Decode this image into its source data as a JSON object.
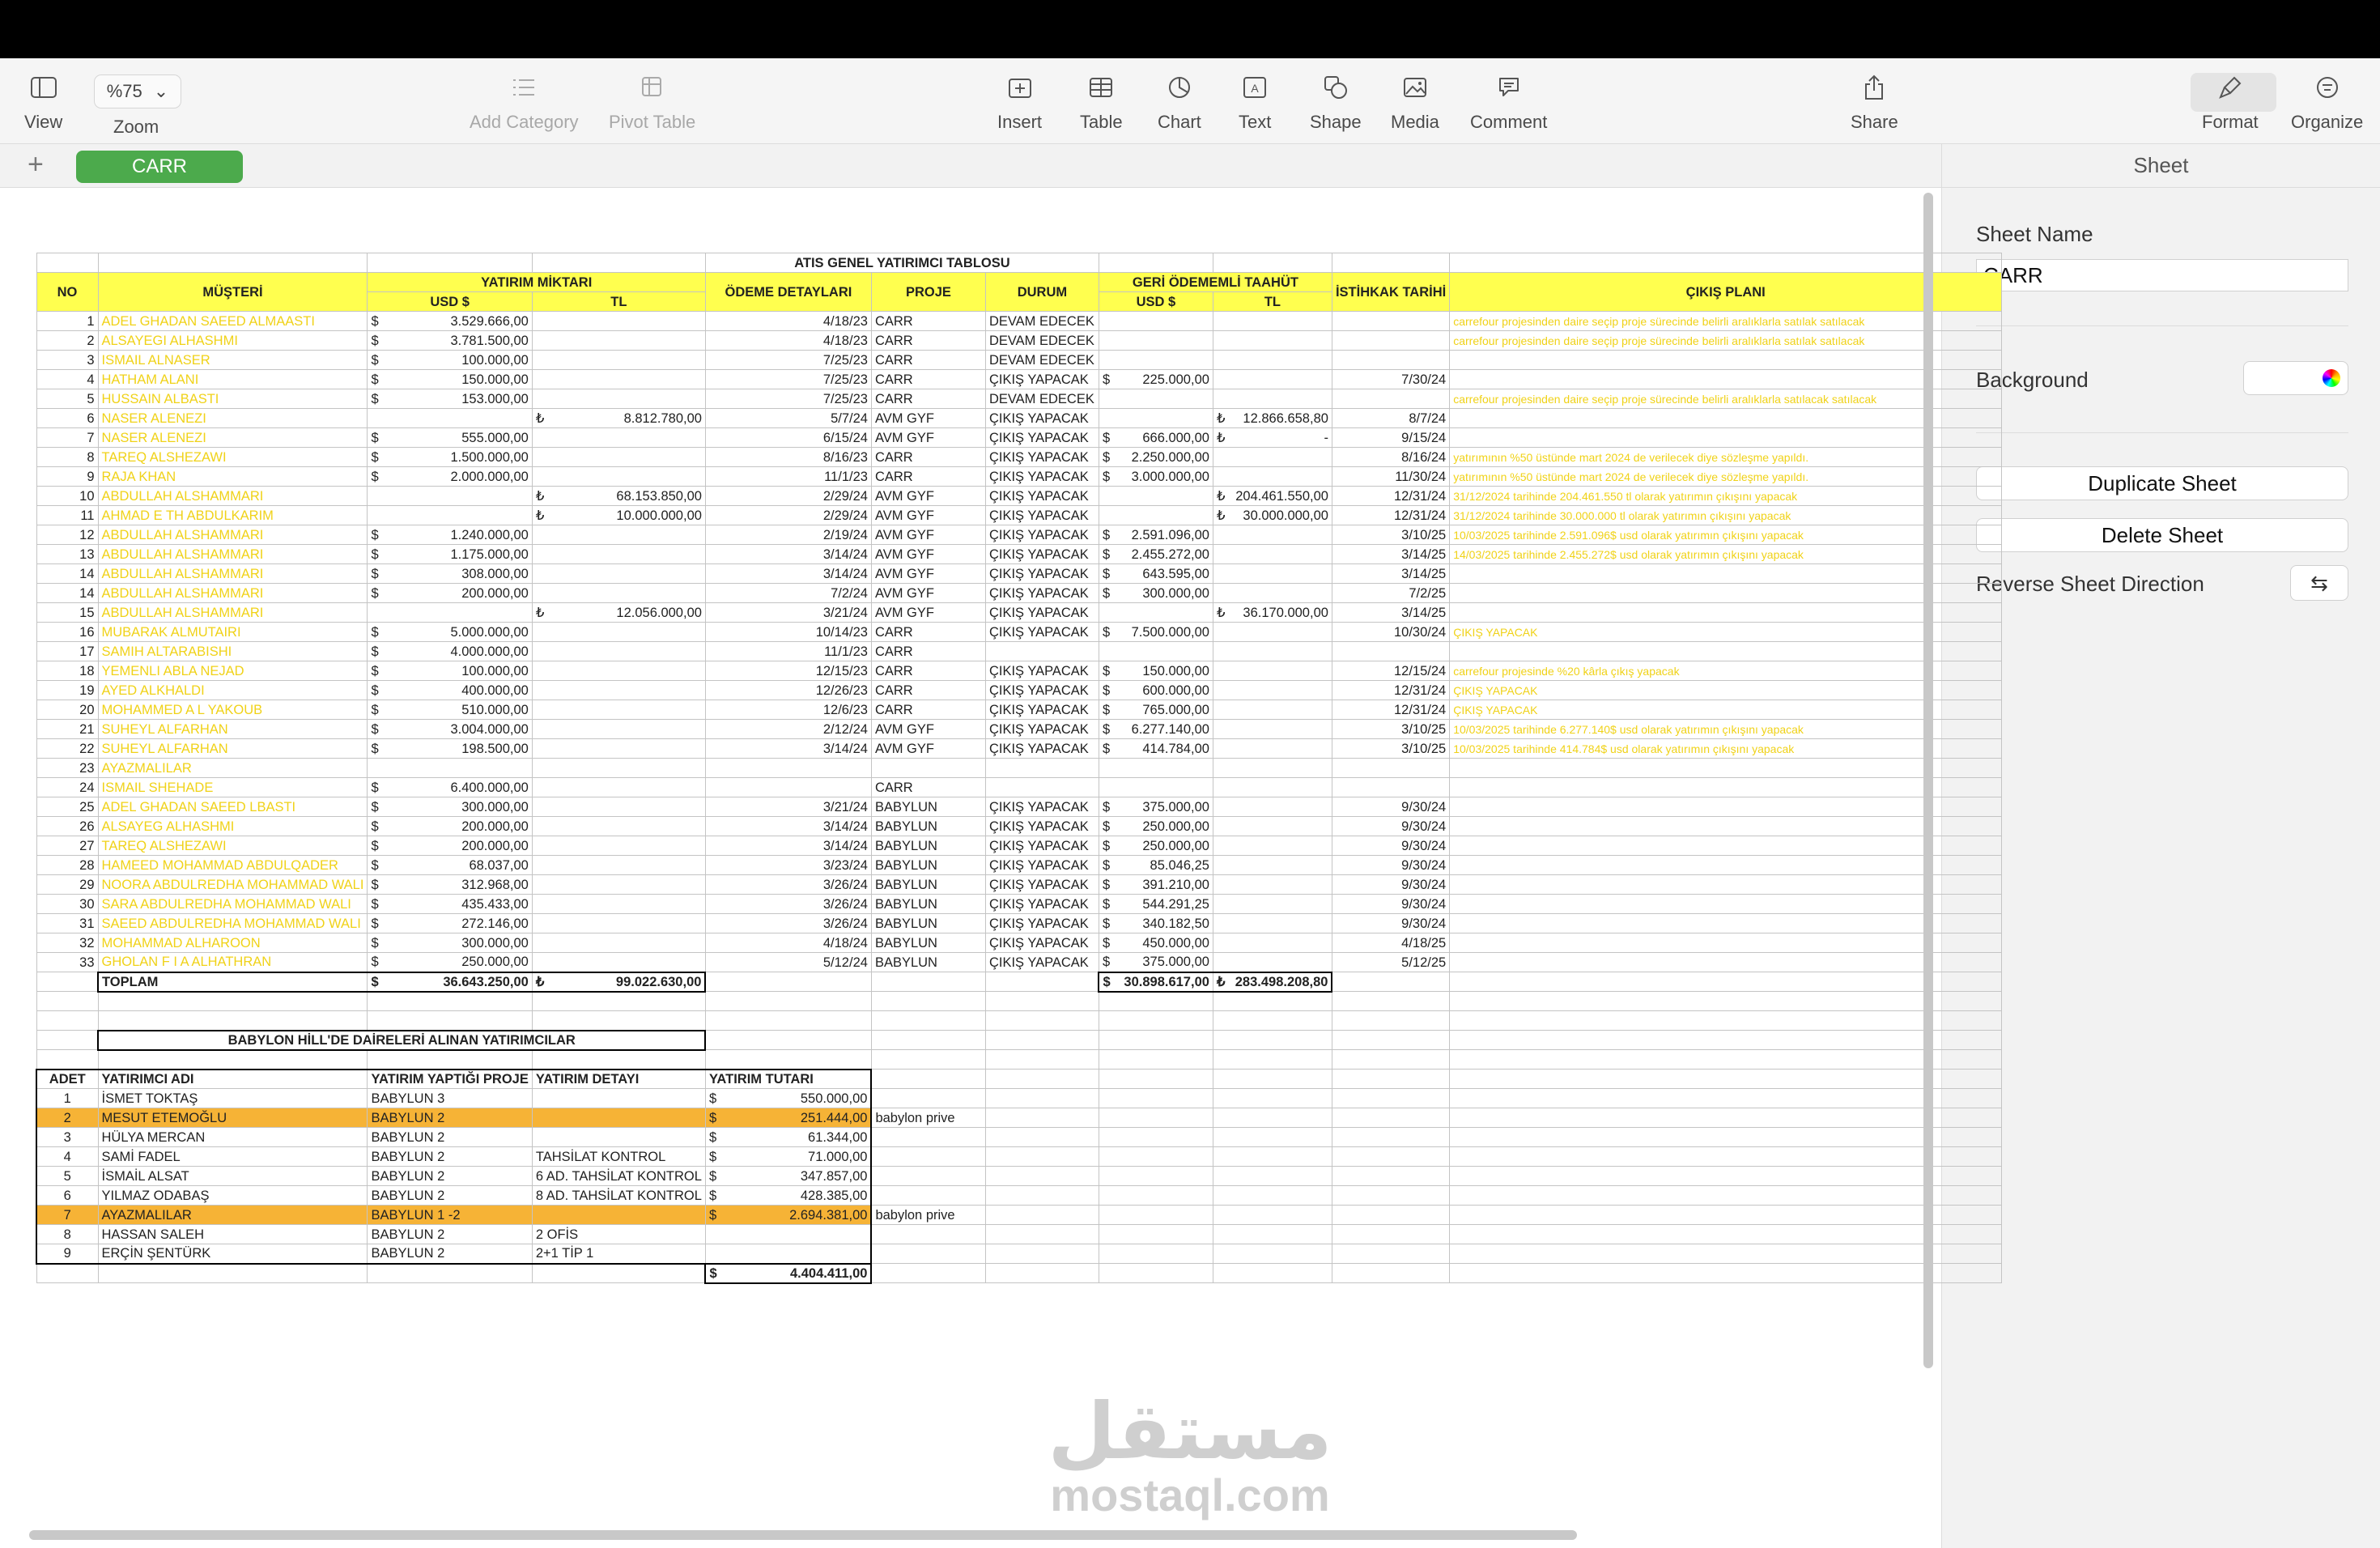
{
  "toolbar": {
    "view": "View",
    "zoom_value": "%75",
    "zoom": "Zoom",
    "add_category": "Add Category",
    "pivot_table": "Pivot Table",
    "insert": "Insert",
    "table": "Table",
    "chart": "Chart",
    "text": "Text",
    "shape": "Shape",
    "media": "Media",
    "comment": "Comment",
    "share": "Share",
    "format": "Format",
    "organize": "Organize"
  },
  "tabs": {
    "add": "+",
    "sheet": "CARR"
  },
  "sidebar": {
    "header": "Sheet",
    "sheet_name_label": "Sheet Name",
    "sheet_name_value": "CARR",
    "background_label": "Background",
    "duplicate": "Duplicate Sheet",
    "delete": "Delete Sheet",
    "reverse": "Reverse Sheet Direction"
  },
  "main": {
    "title": "ATIS GENEL YATIRIMCI TABLOSU",
    "headers": {
      "no": "NO",
      "musteri": "MÜŞTERİ",
      "yatirim": "YATIRIM MİKTARI",
      "usd": "USD $",
      "tl": "TL",
      "odeme": "ÖDEME DETAYLARI",
      "proje": "PROJE",
      "durum": "DURUM",
      "geri": "GERİ ÖDEMEMLİ TAAHÜT",
      "istihkak": "İSTİHKAK TARİHİ",
      "cikis": "ÇIKIŞ PLANI"
    },
    "rows": [
      [
        "1",
        "ADEL GHADAN SAEED ALMAASTI",
        "3.529.666,00",
        "",
        "4/18/23",
        "CARR",
        "DEVAM EDECEK",
        "",
        "",
        "",
        "carrefour projesinden daire seçip proje sürecinde belirli aralıklarla satılak satılacak"
      ],
      [
        "2",
        "ALSAYEGI ALHASHMI",
        "3.781.500,00",
        "",
        "4/18/23",
        "CARR",
        "DEVAM EDECEK",
        "",
        "",
        "",
        "carrefour projesinden daire seçip proje sürecinde belirli aralıklarla satılak satılacak"
      ],
      [
        "3",
        "ISMAIL ALNASER",
        "100.000,00",
        "",
        "7/25/23",
        "CARR",
        "DEVAM EDECEK",
        "",
        "",
        "",
        ""
      ],
      [
        "4",
        "HATHAM ALANI",
        "150.000,00",
        "",
        "7/25/23",
        "CARR",
        "ÇIKIŞ YAPACAK",
        "225.000,00",
        "",
        "7/30/24",
        ""
      ],
      [
        "5",
        "HUSSAIN ALBASTI",
        "153.000,00",
        "",
        "7/25/23",
        "CARR",
        "DEVAM EDECEK",
        "",
        "",
        "",
        "carrefour projesinden daire seçip proje sürecinde belirli aralıklarla satılacak satılacak"
      ],
      [
        "6",
        "NASER ALENEZI",
        "",
        "8.812.780,00",
        "5/7/24",
        "AVM GYF",
        "ÇIKIŞ YAPACAK",
        "",
        "12.866.658,80",
        "8/7/24",
        ""
      ],
      [
        "7",
        "NASER ALENEZI",
        "555.000,00",
        "",
        "6/15/24",
        "AVM GYF",
        "ÇIKIŞ YAPACAK",
        "666.000,00",
        "-",
        "9/15/24",
        ""
      ],
      [
        "8",
        "TAREQ ALSHEZAWI",
        "1.500.000,00",
        "",
        "8/16/23",
        "CARR",
        "ÇIKIŞ YAPACAK",
        "2.250.000,00",
        "",
        "8/16/24",
        "yatırımının %50 üstünde mart 2024 de verilecek diye sözleşme yapıldı."
      ],
      [
        "9",
        "RAJA KHAN",
        "2.000.000,00",
        "",
        "11/1/23",
        "CARR",
        "ÇIKIŞ YAPACAK",
        "3.000.000,00",
        "",
        "11/30/24",
        "yatırımının %50 üstünde mart 2024 de verilecek diye sözleşme yapıldı."
      ],
      [
        "10",
        "ABDULLAH ALSHAMMARI",
        "",
        "68.153.850,00",
        "2/29/24",
        "AVM GYF",
        "ÇIKIŞ YAPACAK",
        "",
        "204.461.550,00",
        "12/31/24",
        "31/12/2024 tarihinde 204.461.550 tl olarak yatırımın çıkışını yapacak"
      ],
      [
        "11",
        "AHMAD E TH ABDULKARIM",
        "",
        "10.000.000,00",
        "2/29/24",
        "AVM GYF",
        "ÇIKIŞ YAPACAK",
        "",
        "30.000.000,00",
        "12/31/24",
        "31/12/2024 tarihinde 30.000.000 tl olarak yatırımın çıkışını yapacak"
      ],
      [
        "12",
        "ABDULLAH ALSHAMMARI",
        "1.240.000,00",
        "",
        "2/19/24",
        "AVM GYF",
        "ÇIKIŞ YAPACAK",
        "2.591.096,00",
        "",
        "3/10/25",
        "10/03/2025 tarihinde 2.591.096$ usd olarak yatırımın çıkışını yapacak"
      ],
      [
        "13",
        "ABDULLAH ALSHAMMARI",
        "1.175.000,00",
        "",
        "3/14/24",
        "AVM GYF",
        "ÇIKIŞ YAPACAK",
        "2.455.272,00",
        "",
        "3/14/25",
        "14/03/2025 tarihinde 2.455.272$ usd olarak yatırımın çıkışını yapacak"
      ],
      [
        "14",
        "ABDULLAH ALSHAMMARI",
        "308.000,00",
        "",
        "3/14/24",
        "AVM GYF",
        "ÇIKIŞ YAPACAK",
        "643.595,00",
        "",
        "3/14/25",
        ""
      ],
      [
        "14",
        "ABDULLAH ALSHAMMARI",
        "200.000,00",
        "",
        "7/2/24",
        "AVM GYF",
        "ÇIKIŞ YAPACAK",
        "300.000,00",
        "",
        "7/2/25",
        ""
      ],
      [
        "15",
        "ABDULLAH ALSHAMMARI",
        "",
        "12.056.000,00",
        "3/21/24",
        "AVM GYF",
        "ÇIKIŞ YAPACAK",
        "",
        "36.170.000,00",
        "3/14/25",
        ""
      ],
      [
        "16",
        "MUBARAK ALMUTAIRI",
        "5.000.000,00",
        "",
        "10/14/23",
        "CARR",
        "ÇIKIŞ YAPACAK",
        "7.500.000,00",
        "",
        "10/30/24",
        "ÇIKIŞ YAPACAK"
      ],
      [
        "17",
        "SAMIH ALTARABISHI",
        "4.000.000,00",
        "",
        "11/1/23",
        "CARR",
        "",
        "",
        "",
        "",
        ""
      ],
      [
        "18",
        "YEMENLI ABLA NEJAD",
        "100.000,00",
        "",
        "12/15/23",
        "CARR",
        "ÇIKIŞ YAPACAK",
        "150.000,00",
        "",
        "12/15/24",
        "carrefour projesinde %20 kârla çıkış yapacak"
      ],
      [
        "19",
        "AYED ALKHALDI",
        "400.000,00",
        "",
        "12/26/23",
        "CARR",
        "ÇIKIŞ YAPACAK",
        "600.000,00",
        "",
        "12/31/24",
        "ÇIKIŞ YAPACAK"
      ],
      [
        "20",
        "MOHAMMED A L YAKOUB",
        "510.000,00",
        "",
        "12/6/23",
        "CARR",
        "ÇIKIŞ YAPACAK",
        "765.000,00",
        "",
        "12/31/24",
        "ÇIKIŞ YAPACAK"
      ],
      [
        "21",
        "SUHEYL ALFARHAN",
        "3.004.000,00",
        "",
        "2/12/24",
        "AVM GYF",
        "ÇIKIŞ YAPACAK",
        "6.277.140,00",
        "",
        "3/10/25",
        "10/03/2025 tarihinde 6.277.140$ usd olarak yatırımın çıkışını yapacak"
      ],
      [
        "22",
        "SUHEYL ALFARHAN",
        "198.500,00",
        "",
        "3/14/24",
        "AVM GYF",
        "ÇIKIŞ YAPACAK",
        "414.784,00",
        "",
        "3/10/25",
        "10/03/2025 tarihinde 414.784$ usd olarak yatırımın çıkışını yapacak"
      ],
      [
        "23",
        "AYAZMALILAR",
        "",
        "",
        "",
        "",
        "",
        "",
        "",
        "",
        ""
      ],
      [
        "24",
        "ISMAIL SHEHADE",
        "6.400.000,00",
        "",
        "",
        "CARR",
        "",
        "",
        "",
        "",
        ""
      ],
      [
        "25",
        "ADEL GHADAN SAEED LBASTI",
        "300.000,00",
        "",
        "3/21/24",
        "BABYLUN",
        "ÇIKIŞ YAPACAK",
        "375.000,00",
        "",
        "9/30/24",
        ""
      ],
      [
        "26",
        "ALSAYEG ALHASHMI",
        "200.000,00",
        "",
        "3/14/24",
        "BABYLUN",
        "ÇIKIŞ YAPACAK",
        "250.000,00",
        "",
        "9/30/24",
        ""
      ],
      [
        "27",
        "TAREQ ALSHEZAWI",
        "200.000,00",
        "",
        "3/14/24",
        "BABYLUN",
        "ÇIKIŞ YAPACAK",
        "250.000,00",
        "",
        "9/30/24",
        ""
      ],
      [
        "28",
        "HAMEED MOHAMMAD ABDULQADER",
        "68.037,00",
        "",
        "3/23/24",
        "BABYLUN",
        "ÇIKIŞ YAPACAK",
        "85.046,25",
        "",
        "9/30/24",
        ""
      ],
      [
        "29",
        "NOORA ABDULREDHA MOHAMMAD WALI",
        "312.968,00",
        "",
        "3/26/24",
        "BABYLUN",
        "ÇIKIŞ YAPACAK",
        "391.210,00",
        "",
        "9/30/24",
        ""
      ],
      [
        "30",
        "SARA ABDULREDHA MOHAMMAD WALI",
        "435.433,00",
        "",
        "3/26/24",
        "BABYLUN",
        "ÇIKIŞ YAPACAK",
        "544.291,25",
        "",
        "9/30/24",
        ""
      ],
      [
        "31",
        "SAEED ABDULREDHA MOHAMMAD WALI",
        "272.146,00",
        "",
        "3/26/24",
        "BABYLUN",
        "ÇIKIŞ YAPACAK",
        "340.182,50",
        "",
        "9/30/24",
        ""
      ],
      [
        "32",
        "MOHAMMAD ALHAROON",
        "300.000,00",
        "",
        "4/18/24",
        "BABYLUN",
        "ÇIKIŞ YAPACAK",
        "450.000,00",
        "",
        "4/18/25",
        ""
      ],
      [
        "33",
        "GHOLAN F I A ALHATHRAN",
        "250.000,00",
        "",
        "5/12/24",
        "BABYLUN",
        "ÇIKIŞ YAPACAK",
        "375.000,00",
        "",
        "5/12/25",
        ""
      ]
    ],
    "totals": {
      "label": "TOPLAM",
      "usd": "36.643.250,00",
      "tl": "99.022.630,00",
      "geri_usd": "30.898.617,00",
      "geri_tl": "283.498.208,80"
    },
    "dollar": "$",
    "lira": "₺",
    "babylon_title": "BABYLON HİLL'DE DAİRELERİ ALINAN YATIRIMCILAR",
    "babylon_headers": [
      "ADET",
      "YATIRIMCI ADI",
      "YATIRIM YAPTIĞI PROJE",
      "YATIRIM DETAYI",
      "YATIRIM TUTARI"
    ],
    "babylon_rows": [
      [
        "1",
        "İSMET TOKTAŞ",
        "BABYLUN 3",
        "",
        "550.000,00",
        ""
      ],
      [
        "2",
        "MESUT ETEMOĞLU",
        "BABYLUN 2",
        "",
        "251.444,00",
        "babylon prive"
      ],
      [
        "3",
        "HÜLYA MERCAN",
        "BABYLUN 2",
        "",
        "61.344,00",
        ""
      ],
      [
        "4",
        "SAMİ FADEL",
        "BABYLUN 2",
        "TAHSİLAT KONTROL",
        "71.000,00",
        ""
      ],
      [
        "5",
        "İSMAİL ALSAT",
        "BABYLUN 2",
        "6 AD. TAHSİLAT KONTROL",
        "347.857,00",
        ""
      ],
      [
        "6",
        "YILMAZ ODABAŞ",
        "BABYLUN 2",
        "8 AD. TAHSİLAT KONTROL",
        "428.385,00",
        ""
      ],
      [
        "7",
        "AYAZMALILAR",
        "BABYLUN 1 -2",
        "",
        "2.694.381,00",
        "babylon prive"
      ],
      [
        "8",
        "HASSAN SALEH",
        "BABYLUN 2",
        "2 OFİS",
        "",
        ""
      ],
      [
        "9",
        "ERÇİN ŞENTÜRK",
        "BABYLUN 2",
        "2+1 TİP 1",
        "",
        ""
      ]
    ],
    "babylon_total": "4.404.411,00"
  },
  "watermark": {
    "arabic": "مستقل",
    "latin": "mostaql.com"
  }
}
